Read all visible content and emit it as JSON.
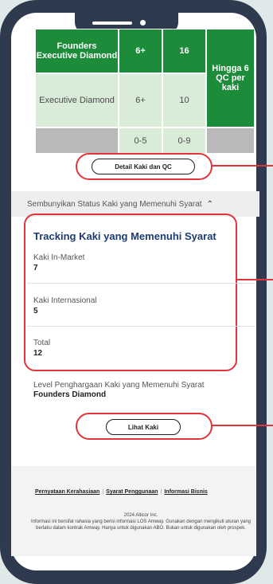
{
  "table": {
    "rows": [
      {
        "name": "Founders Executive Diamond",
        "a": "6+",
        "b": "16"
      },
      {
        "name": "Executive Diamond",
        "a": "6+",
        "b": "10"
      },
      {
        "name": "",
        "a": "0-5",
        "b": "0-9"
      }
    ],
    "right_cell": "Hingga 6 QC per kaki",
    "colors": {
      "dark_green": "#1d8c3a",
      "light_green": "#d9ecd8",
      "gray": "#b9b9b9"
    }
  },
  "detail_button": "Detail Kaki dan QC",
  "hide_status": "Sembunyikan Status Kaki yang Memenuhi Syarat",
  "tracking": {
    "title": "Tracking Kaki yang Memenuhi Syarat",
    "items": [
      {
        "label": "Kaki In-Market",
        "value": "7"
      },
      {
        "label": "Kaki Internasional",
        "value": "5"
      },
      {
        "label": "Total",
        "value": "12"
      }
    ]
  },
  "level": {
    "label": "Level Penghargaan Kaki yang Memenuhi Syarat",
    "value": "Founders Diamond"
  },
  "see_button": "Lihat Kaki",
  "footer": {
    "links": [
      "Pernyataan Kerahasiaan",
      "Syarat Penggunaan",
      "Informasi Bisnis"
    ],
    "copyright": "2024 Alticor Inc.",
    "legal": "Informasi ini bersifat rahasia yang berisi informasi LOS Amway. Gunakan dengan mengikuti aturan yang berlaku dalam kontrak Amway. Hanya untuk digunakan ABO. Bukan untuk digunakan oleh prospek."
  },
  "accent": {
    "highlight": "#e2353b",
    "title": "#1e3c72",
    "phone": "#2e3b4e"
  }
}
